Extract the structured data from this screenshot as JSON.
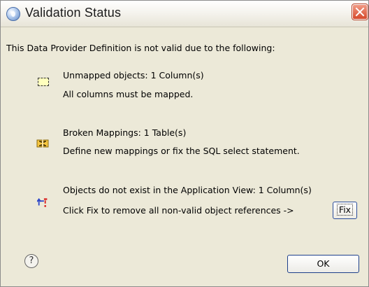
{
  "window": {
    "title": "Validation Status",
    "app_icon": "eclipse-sphere-icon",
    "close_icon": "close-icon"
  },
  "message": {
    "intro": "This Data Provider Definition is not valid due to the following:"
  },
  "issues": [
    {
      "icon": "unmapped-object-icon",
      "heading": "Unmapped objects: 1 Column(s)",
      "detail": "All columns must be mapped."
    },
    {
      "icon": "broken-mapping-icon",
      "heading": "Broken Mappings: 1 Table(s)",
      "detail": "Define new mappings or fix the SQL select statement."
    },
    {
      "icon": "missing-object-icon",
      "heading": "Objects do not exist in the Application View: 1 Column(s)",
      "detail": "Click Fix to remove all non-valid object references ->"
    }
  ],
  "buttons": {
    "fix_label": "Fix",
    "ok_label": "OK",
    "help_symbol": "?",
    "help_icon": "help-icon"
  },
  "colors": {
    "dialog_bg": "#ECE9D8",
    "close_red": "#D6492B",
    "focus_border": "#1D3F8A"
  }
}
